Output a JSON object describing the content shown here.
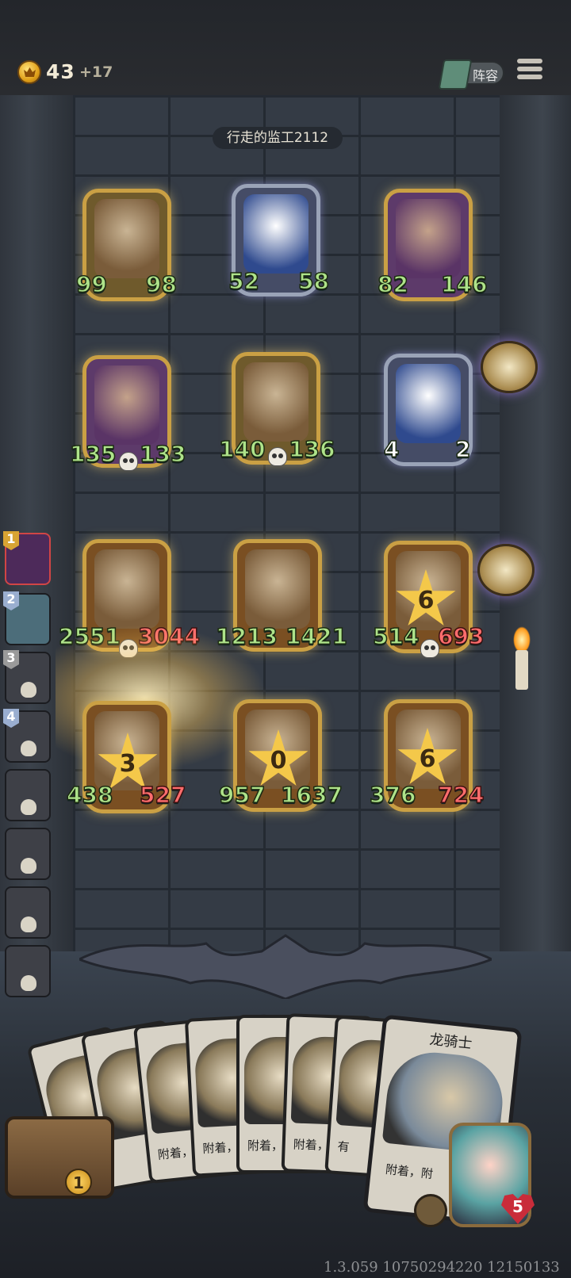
{
  "top_bar": {
    "gold_value": "43",
    "gold_increment": "+17",
    "lineup_label": "阵容"
  },
  "opponent": {
    "name": "行走的监工2112"
  },
  "enemy_board": [
    {
      "attack": "99",
      "health": "98",
      "frame": "gold"
    },
    {
      "attack": "52",
      "health": "58",
      "frame": "silver"
    },
    {
      "attack": "82",
      "health": "146",
      "frame": "gold"
    },
    {
      "attack": "135",
      "health": "133",
      "frame": "gold"
    },
    {
      "attack": "140",
      "health": "136",
      "frame": "gold"
    },
    {
      "attack": "4",
      "health": "2",
      "frame": "silver"
    }
  ],
  "player_board": [
    {
      "attack": "2551",
      "health": "3044"
    },
    {
      "attack": "1213",
      "health": "1421"
    },
    {
      "attack": "514",
      "health": "693",
      "star": "6"
    },
    {
      "attack": "438",
      "health": "527",
      "star": "3"
    },
    {
      "attack": "957",
      "health": "1637",
      "star": "0"
    },
    {
      "attack": "376",
      "health": "724",
      "star": "6"
    }
  ],
  "queue": [
    {
      "rank": "1",
      "active": true
    },
    {
      "rank": "2"
    },
    {
      "rank": "3"
    },
    {
      "rank": "4"
    },
    {
      "rank": ""
    },
    {
      "rank": ""
    },
    {
      "rank": ""
    },
    {
      "rank": ""
    }
  ],
  "hand": {
    "small_card_text": "附着，",
    "small_card_text2": "有",
    "big_card": {
      "title": "龙骑士",
      "text": "附着，附"
    }
  },
  "chest_count": "1",
  "player_health": "5",
  "version": "1.3.059 10750294220 12150133",
  "colors": {
    "attack": "#aee38a",
    "health_red": "#ff6d6d",
    "gold_frame": "#caa044"
  }
}
